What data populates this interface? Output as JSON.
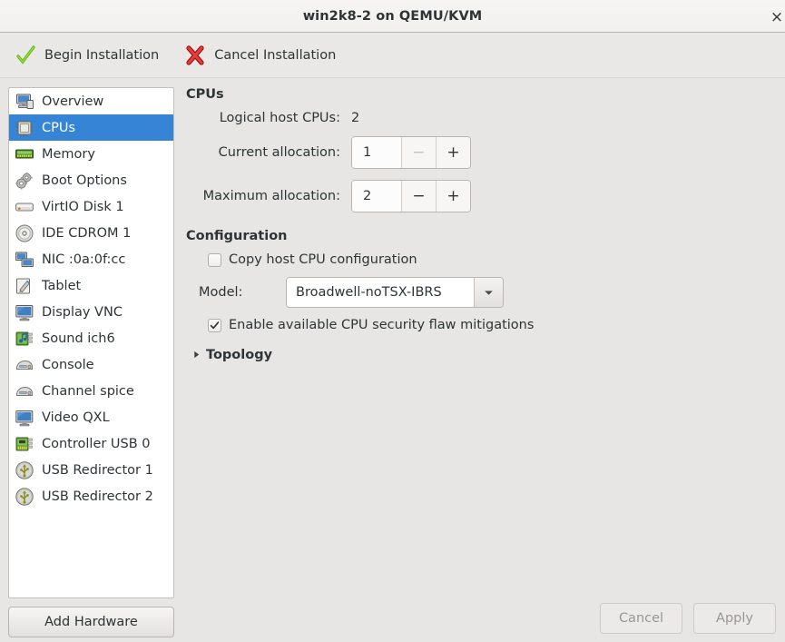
{
  "window": {
    "title": "win2k8-2 on QEMU/KVM",
    "close_label": "×"
  },
  "toolbar": {
    "begin_label": "Begin Installation",
    "begin_icon": "green-check-icon",
    "cancel_label": "Cancel Installation",
    "cancel_icon": "red-x-icon"
  },
  "sidebar": {
    "items": [
      {
        "label": "Overview",
        "icon": "computer-icon"
      },
      {
        "label": "CPUs",
        "icon": "cpu-chip-icon"
      },
      {
        "label": "Memory",
        "icon": "memory-stick-icon"
      },
      {
        "label": "Boot Options",
        "icon": "gears-icon"
      },
      {
        "label": "VirtIO Disk 1",
        "icon": "harddisk-icon"
      },
      {
        "label": "IDE CDROM 1",
        "icon": "optical-disc-icon"
      },
      {
        "label": "NIC :0a:0f:cc",
        "icon": "network-card-icon"
      },
      {
        "label": "Tablet",
        "icon": "tablet-pen-icon"
      },
      {
        "label": "Display VNC",
        "icon": "monitor-icon"
      },
      {
        "label": "Sound ich6",
        "icon": "sound-card-icon"
      },
      {
        "label": "Console",
        "icon": "console-icon"
      },
      {
        "label": "Channel spice",
        "icon": "console-icon"
      },
      {
        "label": "Video QXL",
        "icon": "monitor-icon"
      },
      {
        "label": "Controller USB 0",
        "icon": "controller-card-icon"
      },
      {
        "label": "USB Redirector 1",
        "icon": "usb-icon"
      },
      {
        "label": "USB Redirector 2",
        "icon": "usb-icon"
      }
    ],
    "selected_index": 1,
    "add_hardware_label": "Add Hardware"
  },
  "cpus": {
    "heading": "CPUs",
    "logical_host_label": "Logical host CPUs:",
    "logical_host_value": "2",
    "current_label": "Current allocation:",
    "current_value": "1",
    "current_minus": "−",
    "current_plus": "+",
    "maximum_label": "Maximum allocation:",
    "maximum_value": "2",
    "maximum_minus": "−",
    "maximum_plus": "+"
  },
  "configuration": {
    "heading": "Configuration",
    "copy_host_label": "Copy host CPU configuration",
    "copy_host_checked": false,
    "model_label": "Model:",
    "model_value": "Broadwell-noTSX-IBRS",
    "mitigations_label": "Enable available CPU security flaw mitigations",
    "mitigations_checked": true,
    "topology_label": "Topology",
    "topology_expanded": false
  },
  "footer": {
    "cancel_label": "Cancel",
    "apply_label": "Apply"
  },
  "colors": {
    "selection_blue": "#3584d6",
    "window_bg": "#e7e6e4",
    "titlebar_bg": "#f2f1ef",
    "text": "#2e3436",
    "disabled_text": "#9a9793",
    "check_green": "#73d216",
    "cancel_red": "#cc2222"
  }
}
